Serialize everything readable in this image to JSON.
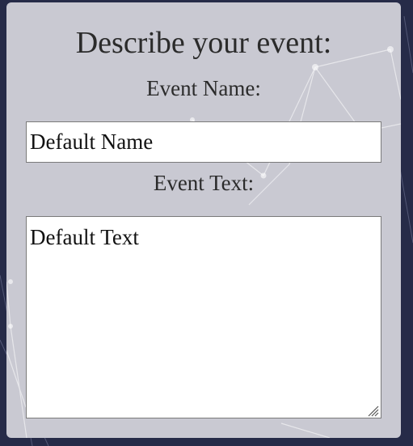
{
  "form": {
    "heading": "Describe your event:",
    "name_label": "Event Name:",
    "name_value": "Default Name",
    "text_label": "Event Text:",
    "text_value": "Default Text"
  },
  "icons": {
    "background": "network-lines-background",
    "resize": "resize-grip-icon"
  },
  "colors": {
    "page_background": "#262b48",
    "panel_background": "#c9c9d2",
    "text": "#2b2b2b"
  }
}
